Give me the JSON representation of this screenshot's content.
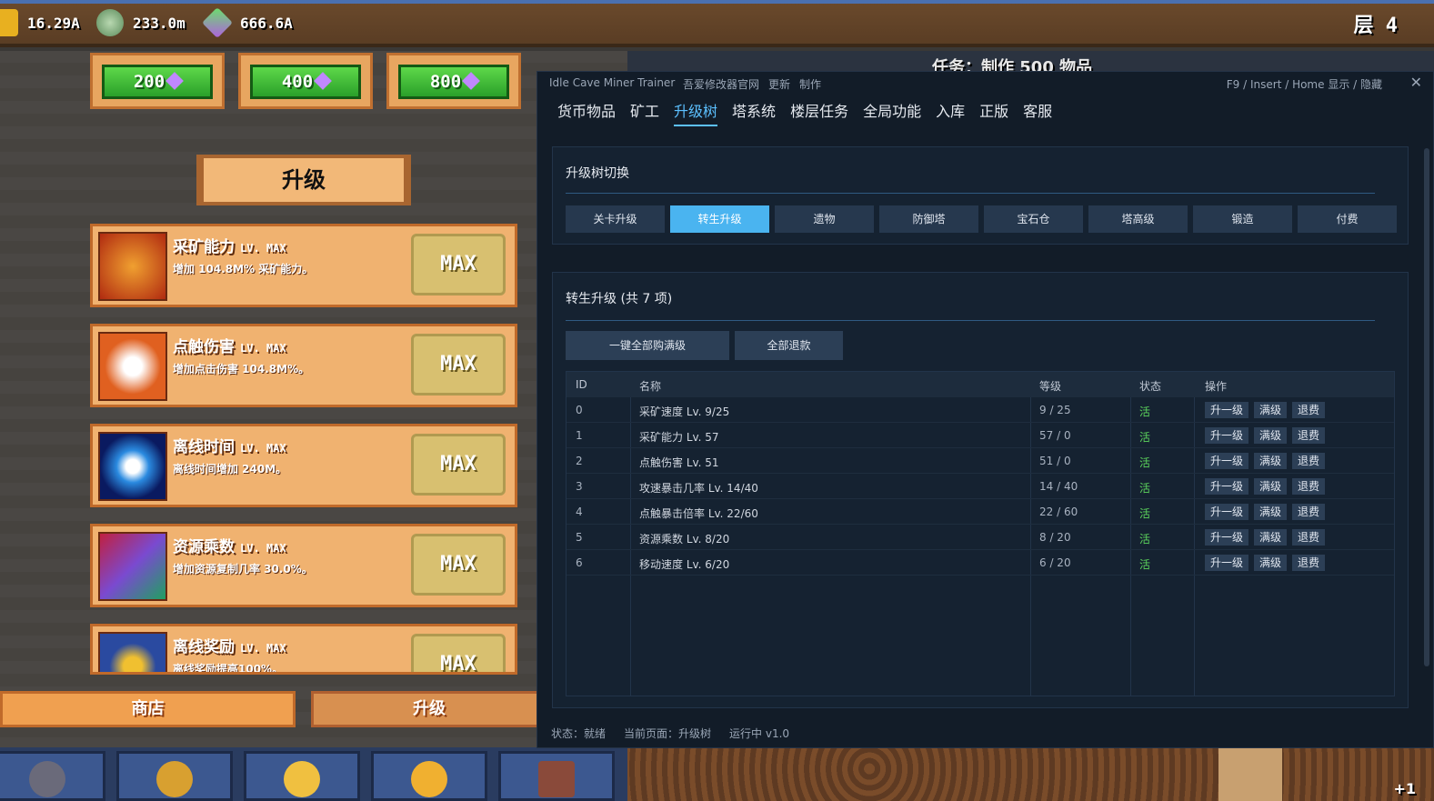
{
  "game": {
    "resources": [
      {
        "icon": "gold-coin-icon",
        "value": "16.29A"
      },
      {
        "icon": "stone-icon",
        "value": "233.0m"
      },
      {
        "icon": "gem-icon",
        "value": "666.6A"
      }
    ],
    "floor": "层 4",
    "task": "任务：制作 500 物品",
    "prices": [
      "200",
      "400",
      "800"
    ],
    "section_title": "升级",
    "upgrades": [
      {
        "name": "采矿能力",
        "level": "LV. MAX",
        "desc": "增加 104.8M% 采矿能力。",
        "button": "MAX",
        "thumb": "#d8501a"
      },
      {
        "name": "点触伤害",
        "level": "LV. MAX",
        "desc": "增加点击伤害 104.8M%。",
        "button": "MAX",
        "thumb": "#e06020"
      },
      {
        "name": "离线时间",
        "level": "LV. MAX",
        "desc": "离线时间增加 240M。",
        "button": "MAX",
        "thumb": "#1a3a9a"
      },
      {
        "name": "资源乘数",
        "level": "LV. MAX",
        "desc": "增加资源复制几率 30.0%。",
        "button": "MAX",
        "thumb": "#5a5a5a"
      },
      {
        "name": "离线奖励",
        "level": "LV. MAX",
        "desc": "离线奖励提高100%。",
        "button": "MAX",
        "thumb": "#2a4aa0"
      }
    ],
    "bottom_tabs": {
      "shop": "商店",
      "upgrade": "升级"
    },
    "plus_one": "+1"
  },
  "trainer": {
    "title": "Idle Cave Miner Trainer",
    "links": [
      "吾爱修改器官网",
      "更新",
      "制作"
    ],
    "hotkey": "F9 / Insert / Home  显示 / 隐藏",
    "close": "✕",
    "nav": [
      "货币物品",
      "矿工",
      "升级树",
      "塔系统",
      "楼层任务",
      "全局功能",
      "入库",
      "正版",
      "客服"
    ],
    "switch_panel": {
      "title": "升级树切换",
      "tabs": [
        "关卡升级",
        "转生升级",
        "遗物",
        "防御塔",
        "宝石仓",
        "塔高级",
        "锻造",
        "付费"
      ]
    },
    "list_panel": {
      "title": "转生升级 (共 7 项)",
      "buy_all": "一键全部购满级",
      "refund_all": "全部退款",
      "headers": {
        "id": "ID",
        "name": "名称",
        "level": "等级",
        "state": "状态",
        "ops": "操作"
      },
      "op_labels": {
        "up": "升一级",
        "max": "满级",
        "refund": "退费"
      },
      "rows": [
        {
          "id": "0",
          "name": "采矿速度 Lv. 9/25",
          "level": "9 / 25",
          "state": "活"
        },
        {
          "id": "1",
          "name": "采矿能力 Lv. 57",
          "level": "57 / 0",
          "state": "活"
        },
        {
          "id": "2",
          "name": "点触伤害 Lv. 51",
          "level": "51 / 0",
          "state": "活"
        },
        {
          "id": "3",
          "name": "攻速暴击几率 Lv. 14/40",
          "level": "14 / 40",
          "state": "活"
        },
        {
          "id": "4",
          "name": "点触暴击倍率 Lv. 22/60",
          "level": "22 / 60",
          "state": "活"
        },
        {
          "id": "5",
          "name": "资源乘数 Lv. 8/20",
          "level": "8 / 20",
          "state": "活"
        },
        {
          "id": "6",
          "name": "移动速度 Lv. 6/20",
          "level": "6 / 20",
          "state": "活"
        }
      ]
    },
    "status": [
      "状态：就绪",
      "当前页面：升级树",
      "运行中  v1.0"
    ]
  },
  "colors": {
    "accent": "#4ab4f0",
    "active_state": "#5cd45c",
    "panel_bg": "#121c28"
  }
}
